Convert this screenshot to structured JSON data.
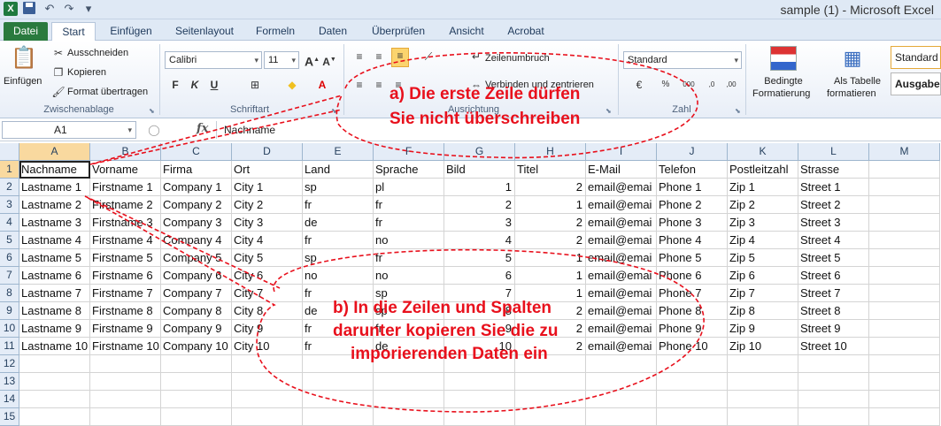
{
  "window": {
    "title": "sample (1)  -  Microsoft Excel",
    "app_icon": "X"
  },
  "ribbon_tabs": [
    "Datei",
    "Start",
    "Einfügen",
    "Seitenlayout",
    "Formeln",
    "Daten",
    "Überprüfen",
    "Ansicht",
    "Acrobat"
  ],
  "clipboard": {
    "paste": "Einfügen",
    "cut": "Ausschneiden",
    "copy": "Kopieren",
    "format_painter": "Format übertragen",
    "group_label": "Zwischenablage"
  },
  "font": {
    "name": "Calibri",
    "size": "11",
    "bold": "F",
    "italic": "K",
    "underline": "U",
    "group_label": "Schriftart"
  },
  "alignment": {
    "wrap_text": "Zeilenumbruch",
    "merge": "Verbinden und zentrieren",
    "group_label": "Ausrichtung"
  },
  "number": {
    "format": "Standard",
    "group_label": "Zahl"
  },
  "styles": {
    "conditional_1": "Bedingte",
    "conditional_2": "Formatierung",
    "table_1": "Als Tabelle",
    "table_2": "formatieren",
    "style_standard": "Standard",
    "style_output": "Ausgabe"
  },
  "formula_bar": {
    "name_box": "A1",
    "fx": "fx",
    "content": "Nachname"
  },
  "columns": [
    "A",
    "B",
    "C",
    "D",
    "E",
    "F",
    "G",
    "H",
    "I",
    "J",
    "K",
    "L",
    "M"
  ],
  "rows": [
    "1",
    "2",
    "3",
    "4",
    "5",
    "6",
    "7",
    "8",
    "9",
    "10",
    "11",
    "12",
    "13",
    "14",
    "15"
  ],
  "cells": [
    [
      "Nachname",
      "Vorname",
      "Firma",
      "Ort",
      "Land",
      "Sprache",
      "Bild",
      "Titel",
      "E-Mail",
      "Telefon",
      "Postleitzahl",
      "Strasse"
    ],
    [
      "Lastname 1",
      "Firstname 1",
      "Company 1",
      "City 1",
      "sp",
      "pl",
      "1",
      "2",
      "email@emai",
      "Phone 1",
      "Zip 1",
      "Street 1"
    ],
    [
      "Lastname 2",
      "Firstname 2",
      "Company 2",
      "City 2",
      "fr",
      "fr",
      "2",
      "1",
      "email@emai",
      "Phone 2",
      "Zip 2",
      "Street 2"
    ],
    [
      "Lastname 3",
      "Firstname 3",
      "Company 3",
      "City 3",
      "de",
      "fr",
      "3",
      "2",
      "email@emai",
      "Phone 3",
      "Zip 3",
      "Street 3"
    ],
    [
      "Lastname 4",
      "Firstname 4",
      "Company 4",
      "City 4",
      "fr",
      "no",
      "4",
      "2",
      "email@emai",
      "Phone 4",
      "Zip 4",
      "Street 4"
    ],
    [
      "Lastname 5",
      "Firstname 5",
      "Company 5",
      "City 5",
      "sp",
      "fr",
      "5",
      "1",
      "email@emai",
      "Phone 5",
      "Zip 5",
      "Street 5"
    ],
    [
      "Lastname 6",
      "Firstname 6",
      "Company 6",
      "City 6",
      "no",
      "no",
      "6",
      "1",
      "email@emai",
      "Phone 6",
      "Zip 6",
      "Street 6"
    ],
    [
      "Lastname 7",
      "Firstname 7",
      "Company 7",
      "City 7",
      "fr",
      "sp",
      "7",
      "1",
      "email@emai",
      "Phone 7",
      "Zip 7",
      "Street 7"
    ],
    [
      "Lastname 8",
      "Firstname 8",
      "Company 8",
      "City 8",
      "de",
      "sp",
      "8",
      "2",
      "email@emai",
      "Phone 8",
      "Zip 8",
      "Street 8"
    ],
    [
      "Lastname 9",
      "Firstname 9",
      "Company 9",
      "City 9",
      "fr",
      "fr",
      "9",
      "2",
      "email@emai",
      "Phone 9",
      "Zip 9",
      "Street 9"
    ],
    [
      "Lastname 10",
      "Firstname 10",
      "Company 10",
      "City 10",
      "fr",
      "de",
      "10",
      "2",
      "email@emai",
      "Phone 10",
      "Zip 10",
      "Street 10"
    ]
  ],
  "annotations": {
    "a_line1": "a) Die erste Zeile dürfen",
    "a_line2": "Sie nicht überschreiben",
    "b_line1": "b) In die Zeilen und Spalten",
    "b_line2": "darunter kopieren Sie die zu",
    "b_line3": "imporierenden Daten ein",
    "color": "#e8101c"
  },
  "colors": {
    "file_tab": "#2a7a3e",
    "header_bg": "#e4ecf7",
    "header_selected": "#f9d99f"
  }
}
